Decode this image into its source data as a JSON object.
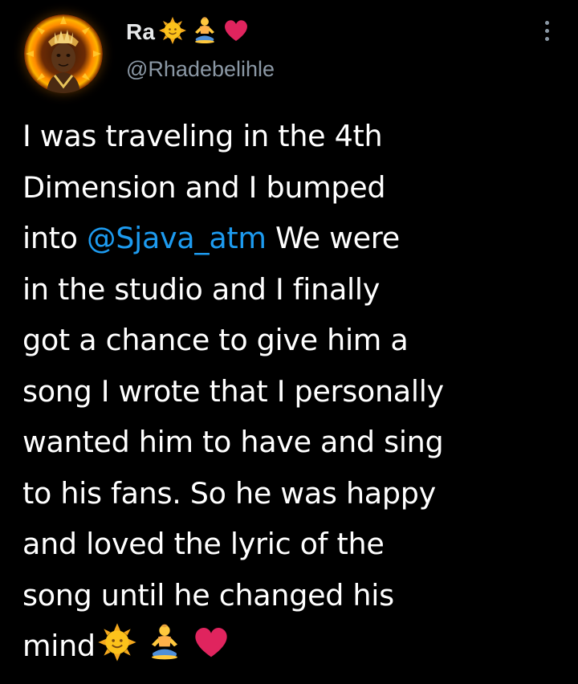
{
  "tweet": {
    "author": {
      "display_name": "Ra",
      "name_emojis": [
        "sun-with-face-icon",
        "person-in-lotus-position-icon",
        "red-heart-icon"
      ],
      "handle": "@Rhadebelihle",
      "avatar": "profile-avatar"
    },
    "more_menu_icon": "vertical-ellipsis-icon",
    "body": {
      "line1": "I was traveling in the 4th",
      "line2": "Dimension and I bumped",
      "line3_before": "into ",
      "mention": "@Sjava_atm",
      "line3_after": " We were",
      "line4": "in the studio and I finally",
      "line5": "got a chance to give him a",
      "line6": "song I wrote that I personally",
      "line7": "wanted him to have and sing",
      "line8": "to his fans. So he was happy",
      "line9": "and loved the lyric of the",
      "line10": "song until he changed his",
      "line11": "mind",
      "end_emojis": [
        "sun-with-face-icon",
        "person-in-lotus-position-icon",
        "red-heart-icon"
      ]
    }
  },
  "colors": {
    "background": "#000000",
    "text": "#ffffff",
    "handle": "#8b98a5",
    "mention": "#1d9bf0",
    "heart": "#e0245e"
  }
}
